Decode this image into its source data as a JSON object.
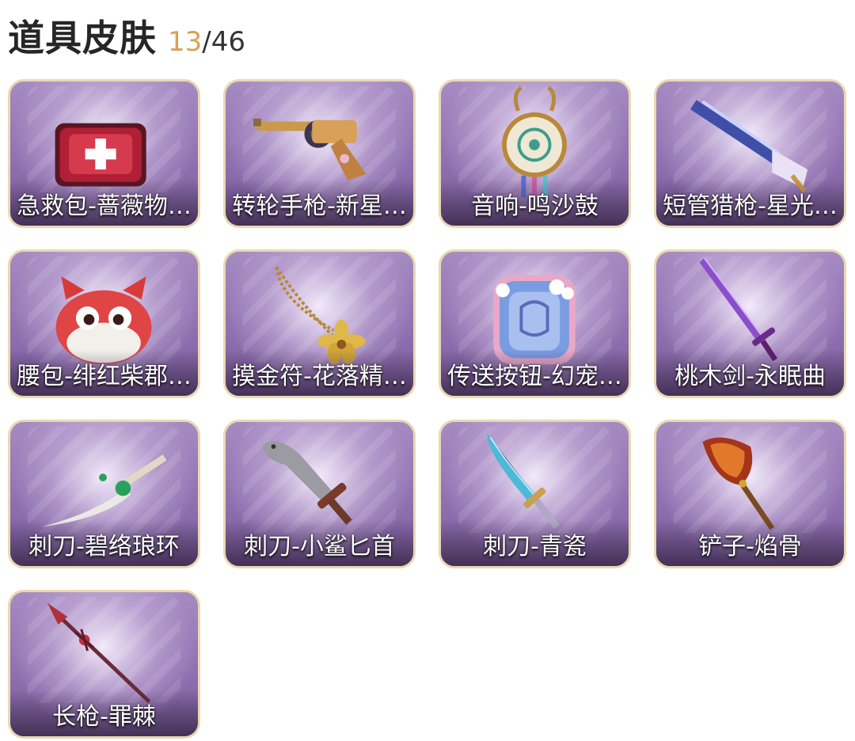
{
  "header": {
    "title": "道具皮肤",
    "owned": "13",
    "separator": "/",
    "total": "46"
  },
  "items": [
    {
      "label": "急救包-蔷薇物…",
      "icon": "first-aid-kit-icon"
    },
    {
      "label": "转轮手枪-新星…",
      "icon": "revolver-icon"
    },
    {
      "label": "音响-鸣沙鼓",
      "icon": "drum-speaker-icon"
    },
    {
      "label": "短管猎枪-星光…",
      "icon": "shotgun-icon"
    },
    {
      "label": "腰包-绯红柴郡…",
      "icon": "cat-waist-bag-icon"
    },
    {
      "label": "摸金符-花落精…",
      "icon": "flower-amulet-icon"
    },
    {
      "label": "传送按钮-幻宠…",
      "icon": "teleport-button-icon"
    },
    {
      "label": "桃木剑-永眠曲",
      "icon": "purple-sword-icon"
    },
    {
      "label": "刺刀-碧络琅环",
      "icon": "jade-dagger-icon"
    },
    {
      "label": "刺刀-小鲨匕首",
      "icon": "shark-dagger-icon"
    },
    {
      "label": "刺刀-青瓷",
      "icon": "celadon-dagger-icon"
    },
    {
      "label": "铲子-焰骨",
      "icon": "flame-shovel-icon"
    },
    {
      "label": "长枪-罪棘",
      "icon": "thorn-spear-icon"
    }
  ]
}
